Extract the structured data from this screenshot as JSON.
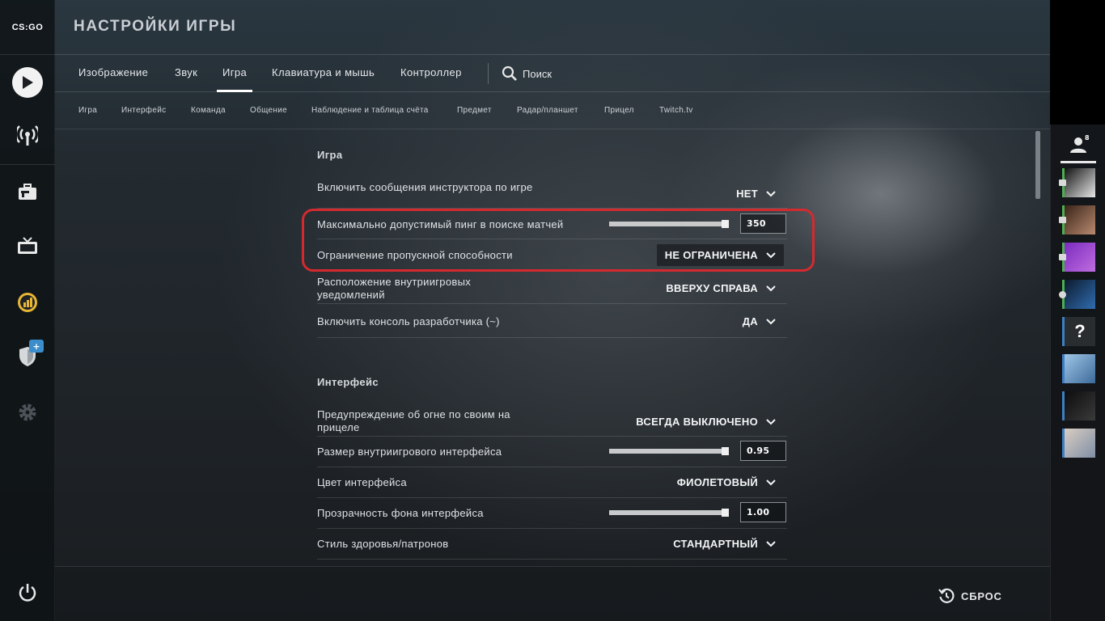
{
  "app": {
    "logo_text": "CS:GO"
  },
  "header": {
    "title": "НАСТРОЙКИ ИГРЫ"
  },
  "tabs": [
    {
      "label": "Изображение"
    },
    {
      "label": "Звук"
    },
    {
      "label": "Игра",
      "active": true
    },
    {
      "label": "Клавиатура и мышь"
    },
    {
      "label": "Контроллер"
    }
  ],
  "search": {
    "label": "Поиск",
    "icon": "search-icon"
  },
  "subtabs": [
    {
      "label": "Игра"
    },
    {
      "label": "Интерфейс"
    },
    {
      "label": "Команда"
    },
    {
      "label": "Общение"
    },
    {
      "label": "Наблюдение и таблица счёта"
    },
    {
      "label": "Предмет"
    },
    {
      "label": "Радар/планшет"
    },
    {
      "label": "Прицел"
    },
    {
      "label": "Twitch.tv"
    }
  ],
  "sections": {
    "game": {
      "title": "Игра",
      "instructor": {
        "label": "Включить сообщения инструктора по игре",
        "value": "НЕТ"
      },
      "max_ping": {
        "label": "Максимально допустимый пинг в поиске матчей",
        "value": "350",
        "slider_fraction": 0.98
      },
      "bandwidth": {
        "label": "Ограничение пропускной способности",
        "value": "НЕ ОГРАНИЧЕНА"
      },
      "notif_pos": {
        "label": "Расположение внутриигровых уведомлений",
        "value": "ВВЕРХУ СПРАВА"
      },
      "console": {
        "label": "Включить консоль разработчика (~)",
        "value": "ДА"
      }
    },
    "interface": {
      "title": "Интерфейс",
      "friendly_fire": {
        "label": "Предупреждение об огне по своим на прицеле",
        "value": "ВСЕГДА ВЫКЛЮЧЕНО"
      },
      "hud_scale": {
        "label": "Размер внутриигрового интерфейса",
        "value": "0.95",
        "slider_fraction": 0.98
      },
      "hud_color": {
        "label": "Цвет интерфейса",
        "value": "ФИОЛЕТОВЫЙ"
      },
      "hud_alpha": {
        "label": "Прозрачность фона интерфейса",
        "value": "1.00",
        "slider_fraction": 1.0
      },
      "health_style": {
        "label": "Стиль здоровья/патронов",
        "value": "СТАНДАРТНЫЙ"
      }
    }
  },
  "footer": {
    "reset_label": "СБРОС"
  },
  "friends": {
    "count": "8",
    "unknown_avatar_glyph": "?",
    "items": [
      {
        "status_color": "#4caf50",
        "avatar_colors": [
          "#111111",
          "#e8e8e8"
        ]
      },
      {
        "status_color": "#4caf50",
        "avatar_colors": [
          "#3a2418",
          "#b88a70"
        ]
      },
      {
        "status_color": "#4caf50",
        "avatar_colors": [
          "#7b2bbf",
          "#c06de0"
        ]
      },
      {
        "status_color": "#4caf50",
        "avatar_colors": [
          "#0d1a2e",
          "#2f6db0"
        ]
      },
      {
        "status_color": "#3d7fc4",
        "avatar_colors": [
          "#2a2d30",
          "#2a2d30"
        ]
      },
      {
        "status_color": "#3d7fc4",
        "avatar_colors": [
          "#9ec6e6",
          "#3d6a9a"
        ]
      },
      {
        "status_color": "#3d7fc4",
        "avatar_colors": [
          "#0d0d0d",
          "#3a3a3a"
        ]
      },
      {
        "status_color": "#3d7fc4",
        "avatar_colors": [
          "#d9cdc2",
          "#7f8fa6"
        ]
      }
    ]
  },
  "colors": {
    "highlight": "#d42a2f",
    "rail_badge": "#3b8dcc"
  }
}
